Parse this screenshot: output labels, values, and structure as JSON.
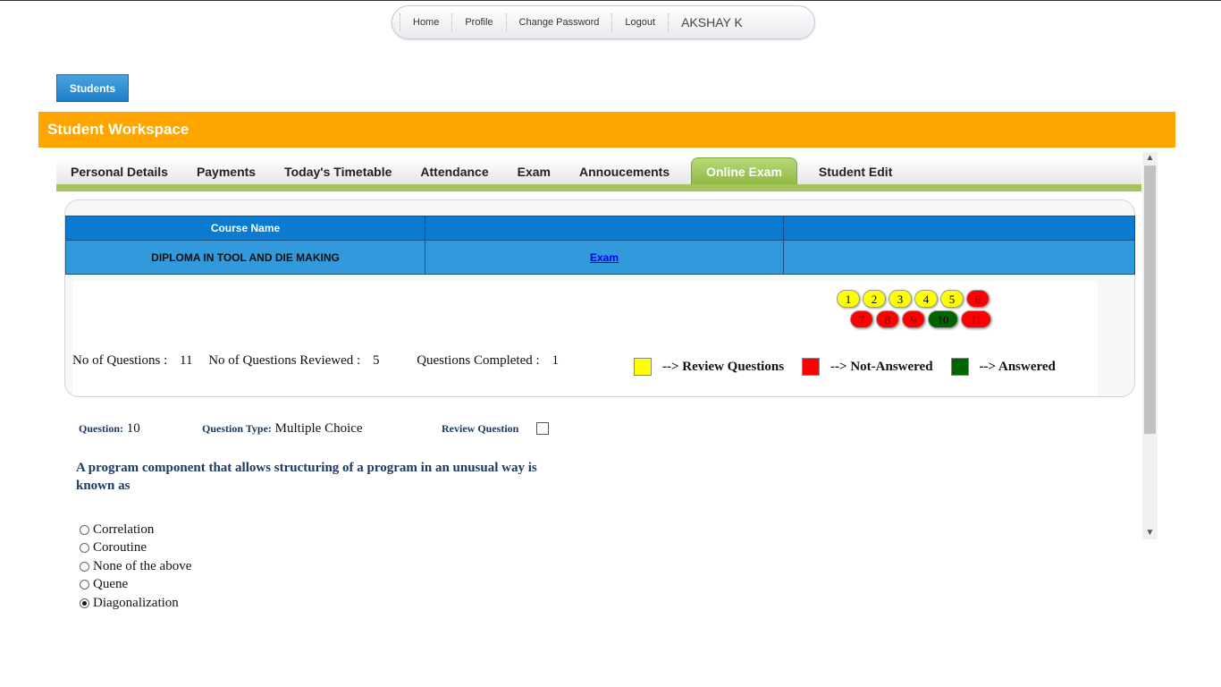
{
  "nav": {
    "items": [
      "Home",
      "Profile",
      "Change Password",
      "Logout"
    ],
    "user": "AKSHAY K"
  },
  "students_button": "Students",
  "workspace_title": "Student Workspace",
  "tabs": [
    "Personal Details",
    "Payments",
    "Today's Timetable",
    "Attendance",
    "Exam",
    "Annoucements",
    "Online Exam",
    "Student Edit"
  ],
  "active_tab": "Online Exam",
  "course_table": {
    "header": "Course Name",
    "course": "DIPLOMA IN TOOL AND DIE MAKING",
    "exam_link": "Exam"
  },
  "questions": {
    "items": [
      {
        "n": "1",
        "status": "review"
      },
      {
        "n": "2",
        "status": "review"
      },
      {
        "n": "3",
        "status": "review"
      },
      {
        "n": "4",
        "status": "review"
      },
      {
        "n": "5",
        "status": "review"
      },
      {
        "n": "6",
        "status": "not-answered"
      },
      {
        "n": "7",
        "status": "not-answered"
      },
      {
        "n": "8",
        "status": "not-answered"
      },
      {
        "n": "9",
        "status": "not-answered"
      },
      {
        "n": "10",
        "status": "answered"
      },
      {
        "n": "11",
        "status": "not-answered"
      }
    ]
  },
  "stats": {
    "no_questions_label": "No of Questions :",
    "no_questions": "11",
    "reviewed_label": "No of Questions Reviewed :",
    "reviewed": "5",
    "completed_label": "Questions Completed :",
    "completed": "1"
  },
  "legend": {
    "review": "--> Review Questions",
    "not_answered": "--> Not-Answered",
    "answered": "--> Answered",
    "colors": {
      "review": "#ffff00",
      "not_answered": "#ff0000",
      "answered": "#006400"
    }
  },
  "question": {
    "number_label": "Question:",
    "number": "10",
    "type_label": "Question Type:",
    "type": "Multiple Choice",
    "review_label": "Review Question",
    "text": "A program component that allows structuring of a program in an unusual way is known as",
    "options": [
      "Correlation",
      "Coroutine",
      "None of the above",
      "Quene",
      "Diagonalization"
    ],
    "selected_index": 4
  }
}
